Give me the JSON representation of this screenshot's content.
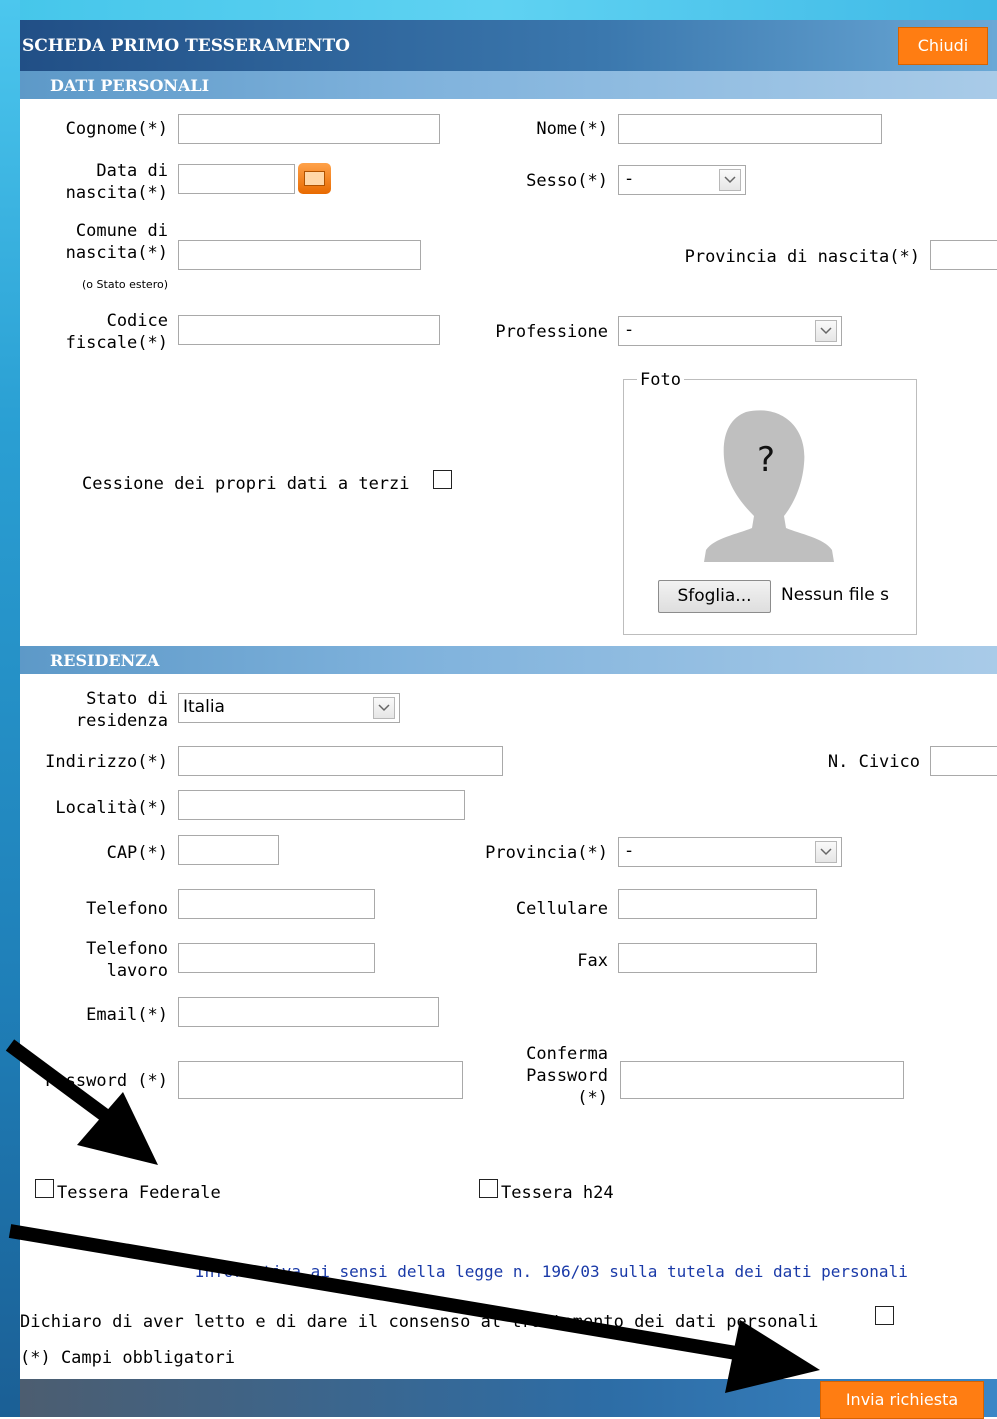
{
  "header": {
    "title": "SCHEDA PRIMO TESSERAMENTO",
    "close_label": "Chiudi"
  },
  "sections": {
    "personal": "DATI PERSONALI",
    "residence": "RESIDENZA"
  },
  "personal": {
    "surname_label": "Cognome(*)",
    "name_label": "Nome(*)",
    "birth_date_label": "Data di\nnascita(*)",
    "sex_label": "Sesso(*)",
    "sex_value": "-",
    "birth_city_label": "Comune di\nnascita(*)",
    "birth_city_note": "(o Stato estero)",
    "birth_province_label": "Provincia di nascita(*)",
    "tax_code_label": "Codice\nfiscale(*)",
    "profession_label": "Professione",
    "profession_value": "-",
    "consent_third_label": "Cessione dei propri dati a terzi",
    "photo_legend": "Foto",
    "photo_placeholder": "?",
    "browse_label": "Sfoglia...",
    "no_file_label": "Nessun file s"
  },
  "residence": {
    "country_label": "Stato di\nresidenza",
    "country_value": "Italia",
    "address_label": "Indirizzo(*)",
    "street_number_label": "N. Civico",
    "locality_label": "Località(*)",
    "cap_label": "CAP(*)",
    "province_label": "Provincia(*)",
    "province_value": "-",
    "phone_label": "Telefono",
    "mobile_label": "Cellulare",
    "work_phone_label": "Telefono\nlavoro",
    "fax_label": "Fax",
    "email_label": "Email(*)",
    "password_label": "Password (*)",
    "confirm_password_label": "Conferma\nPassword\n(*)"
  },
  "options": {
    "federal_card": "Tessera Federale",
    "h24_card": "Tessera h24"
  },
  "privacy": {
    "link_text": "Informativa ai sensi della legge n. 196/03 sulla tutela dei dati personali",
    "declaration": "Dichiaro di aver letto e di dare il consenso al trattamento dei dati personali",
    "required_note": "(*) Campi obbligatori"
  },
  "footer": {
    "submit_label": "Invia richiesta"
  },
  "colors": {
    "accent": "#ff7d12",
    "header": "#2a5f96",
    "section": "#7fb2dc",
    "link": "#1a3aa8"
  }
}
